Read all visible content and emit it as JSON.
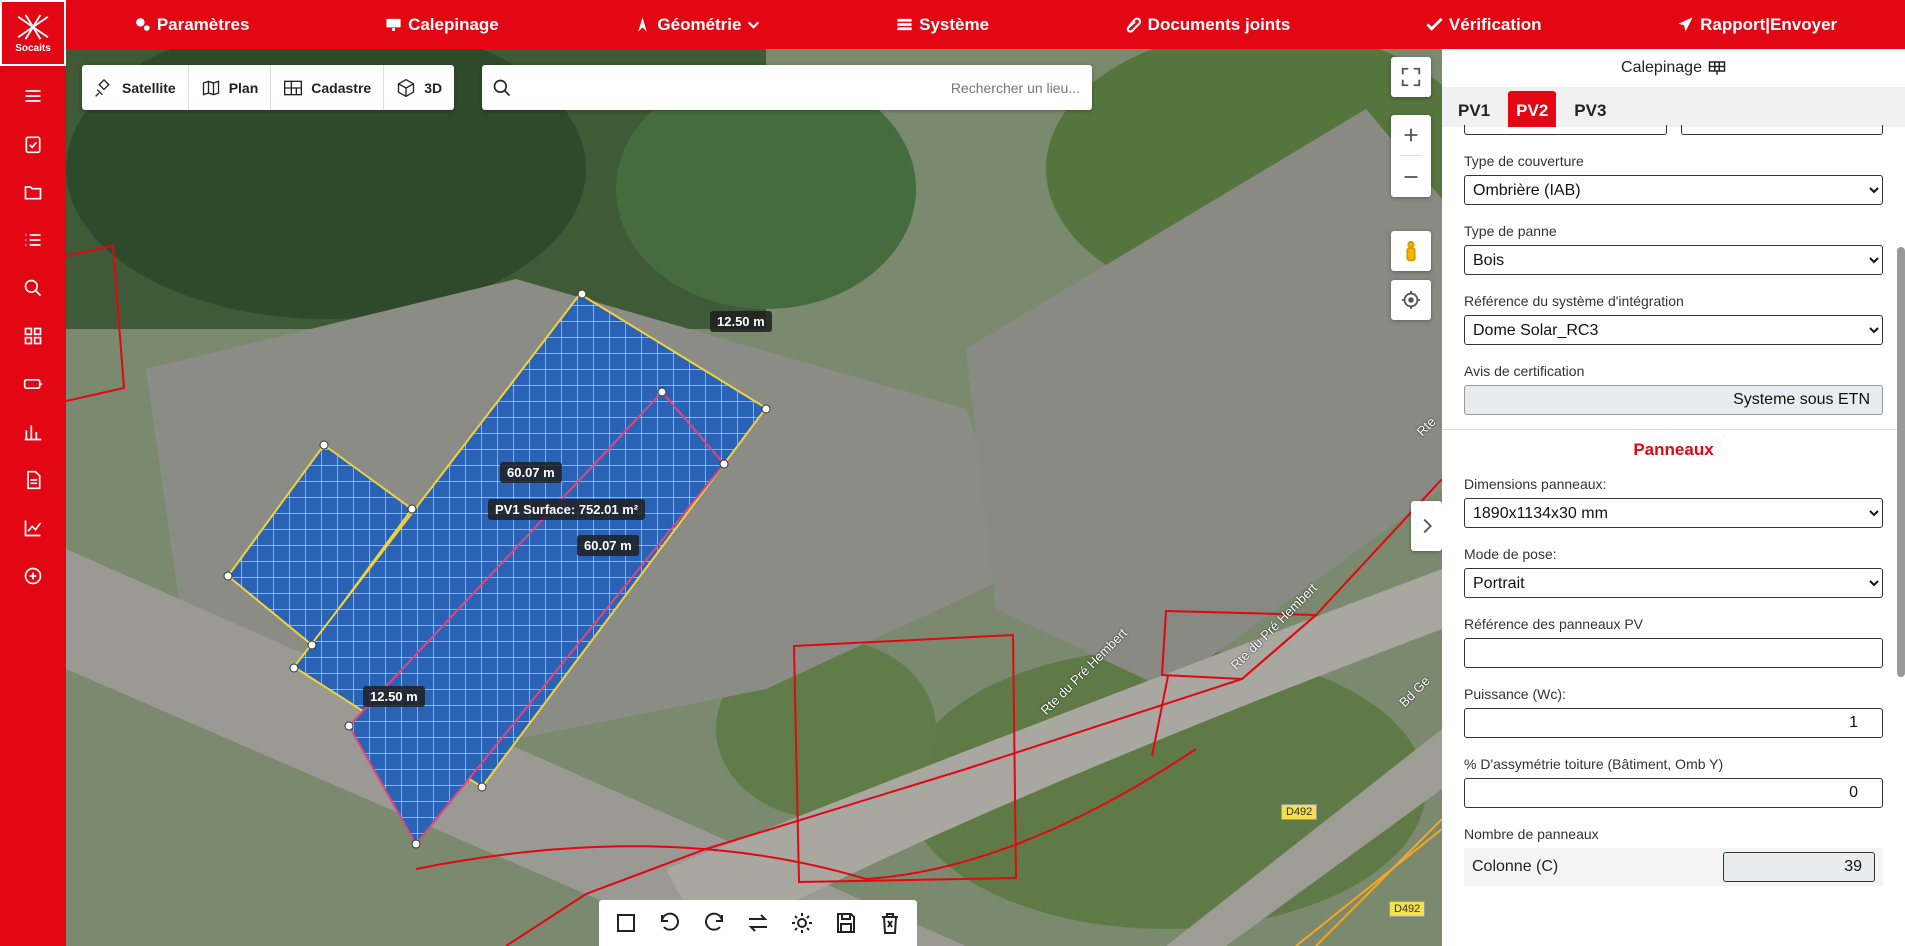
{
  "logo": {
    "text": "Socaits"
  },
  "nav": [
    {
      "label": "Paramètres",
      "icon": "gears-icon"
    },
    {
      "label": "Calepinage",
      "icon": "solar-panel-icon"
    },
    {
      "label": "Géométrie",
      "icon": "compass-icon"
    },
    {
      "label": "Système",
      "icon": "list-icon"
    },
    {
      "label": "Documents joints",
      "icon": "paperclip-icon"
    },
    {
      "label": "Vérification",
      "icon": "check-double-icon"
    },
    {
      "label": "Rapport|Envoyer",
      "icon": "send-icon"
    }
  ],
  "map": {
    "layers": [
      {
        "label": "Satellite",
        "icon": "satellite-icon"
      },
      {
        "label": "Plan",
        "icon": "map-icon"
      },
      {
        "label": "Cadastre",
        "icon": "cadastre-icon"
      },
      {
        "label": "3D",
        "icon": "cube-icon"
      }
    ],
    "search_placeholder": "Rechercher un lieu...",
    "measures": {
      "m1": "12.50 m",
      "m2": "60.07 m",
      "m3": "PV1 Surface: 752.01 m²",
      "m4": "60.07 m",
      "m5": "12.50 m"
    },
    "road_labels": {
      "r1": "Rte du Pré Hembert",
      "r2": "Rte du Pré Hembert",
      "d1": "D492",
      "d2": "D492",
      "bd": "Bd Ge",
      "rte": "Rte"
    }
  },
  "panel": {
    "title": "Calepinage",
    "tabs": [
      "PV1",
      "PV2",
      "PV3"
    ],
    "active_tab": "PV2",
    "fields": {
      "couverture": {
        "label": "Type de couverture",
        "value": "Ombrière (IAB)"
      },
      "panne": {
        "label": "Type de panne",
        "value": "Bois"
      },
      "systeme": {
        "label": "Référence du système d'intégration",
        "value": "Dome Solar_RC3"
      },
      "avis": {
        "label": "Avis de certification",
        "value": "Systeme sous ETN"
      }
    },
    "section": "Panneaux",
    "panneaux": {
      "dimensions": {
        "label": "Dimensions panneaux:",
        "value": "1890x1134x30 mm"
      },
      "pose": {
        "label": "Mode de pose:",
        "value": "Portrait"
      },
      "reference": {
        "label": "Référence des panneaux PV",
        "value": ""
      },
      "puissance": {
        "label": "Puissance (Wc):",
        "value": "1"
      },
      "asymetrie": {
        "label": "% D'assymétrie toiture (Bâtiment, Omb Y)",
        "value": "0"
      },
      "nombre": {
        "label": "Nombre de panneaux"
      },
      "colonne": {
        "label": "Colonne (C)",
        "value": "39"
      }
    }
  }
}
